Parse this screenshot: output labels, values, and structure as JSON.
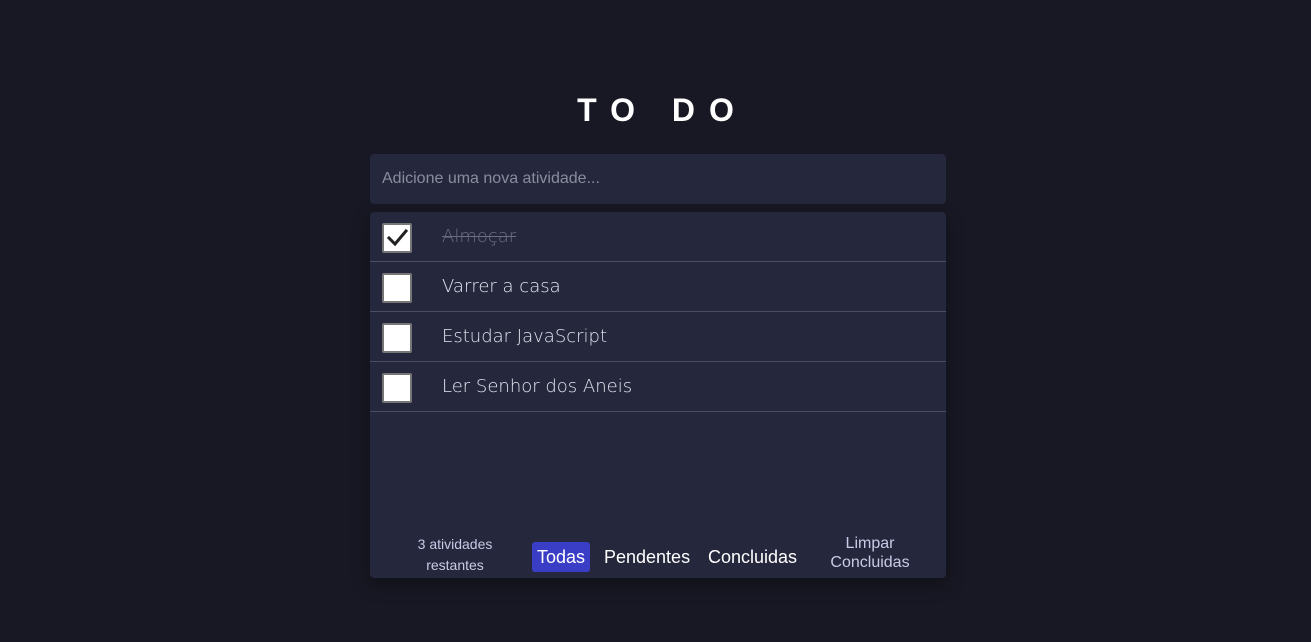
{
  "app": {
    "title": "TO DO"
  },
  "new_todo": {
    "placeholder": "Adicione uma nova atividade...",
    "value": ""
  },
  "todos": [
    {
      "text": "Almoçar",
      "completed": true
    },
    {
      "text": "Varrer a casa",
      "completed": false
    },
    {
      "text": "Estudar JavaScript",
      "completed": false
    },
    {
      "text": "Ler Senhor dos Aneis",
      "completed": false
    }
  ],
  "footer": {
    "count_line1": "3 atividades",
    "count_line2": "restantes",
    "filters": [
      {
        "label": "Todas",
        "active": true
      },
      {
        "label": "Pendentes",
        "active": false
      },
      {
        "label": "Concluidas",
        "active": false
      }
    ],
    "clear_line1": "Limpar",
    "clear_line2": "Concluidas"
  },
  "colors": {
    "background": "#181824",
    "card": "#25273c",
    "active_filter": "#3a3ec6"
  }
}
